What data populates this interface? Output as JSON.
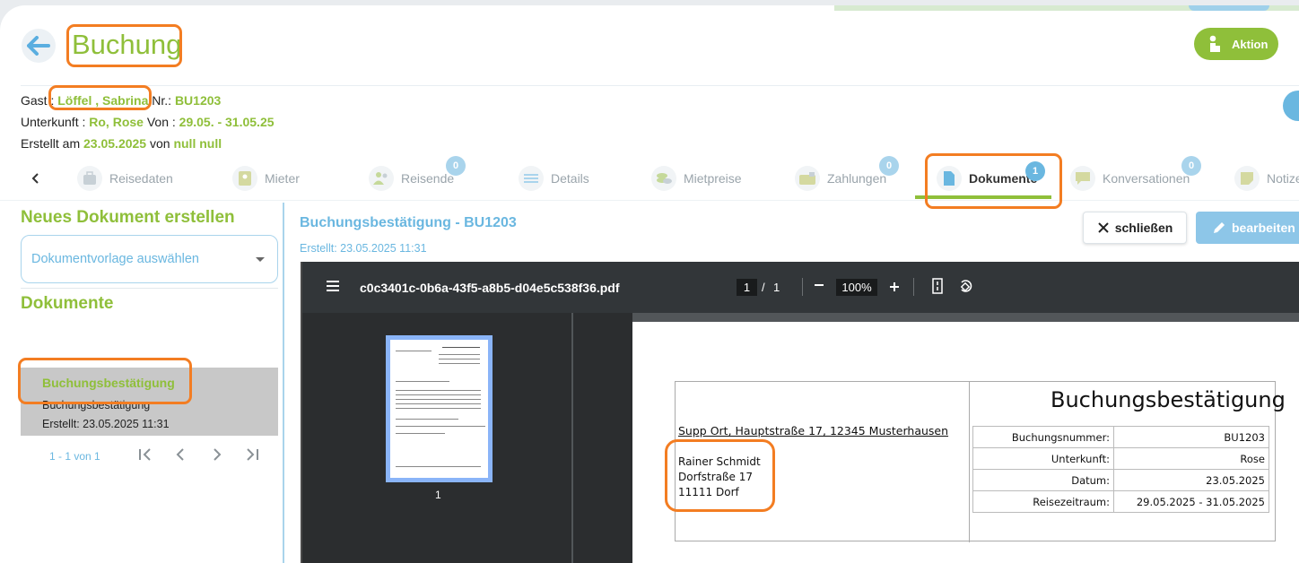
{
  "header": {
    "title": "Buchung",
    "action_label": "Aktion"
  },
  "info": {
    "guest_label": "Gast :",
    "guest_name": "Löffel , Sabrina",
    "nr_label": "Nr.:",
    "nr_value": "BU1203",
    "accommodation_label": "Unterkunft :",
    "accommodation_value": "Ro, Rose",
    "from_label": "Von :",
    "date_range": "29.05. - 31.05.25",
    "created_label": "Erstellt am",
    "created_date": "23.05.2025",
    "by_label": "von",
    "created_by": "null null"
  },
  "tabs": [
    {
      "label": "Reisedaten",
      "icon": "suitcase-icon"
    },
    {
      "label": "Mieter",
      "icon": "contact-card-icon"
    },
    {
      "label": "Reisende",
      "icon": "people-icon",
      "badge": "0"
    },
    {
      "label": "Details",
      "icon": "lines-icon"
    },
    {
      "label": "Mietpreise",
      "icon": "coins-icon"
    },
    {
      "label": "Zahlungen",
      "icon": "wallet-icon",
      "badge": "0"
    },
    {
      "label": "Dokumente",
      "icon": "document-icon",
      "badge": "1",
      "active": true
    },
    {
      "label": "Konversationen",
      "icon": "chat-icon",
      "badge": "0"
    },
    {
      "label": "Notize",
      "icon": "note-icon"
    }
  ],
  "left": {
    "new_doc_title": "Neues Dokument erstellen",
    "template_placeholder": "Dokumentvorlage auswählen",
    "docs_title": "Dokumente",
    "doc_item": {
      "name": "Buchungsbestätigung",
      "type": "Buchungsbestätigung",
      "created": "Erstellt: 23.05.2025 11:31"
    },
    "pager_text": "1 - 1 von 1"
  },
  "doc": {
    "title": "Buchungsbestätigung - BU1203",
    "created": "Erstellt: 23.05.2025 11:31",
    "close_label": "schließen",
    "edit_label": "bearbeiten"
  },
  "viewer": {
    "filename": "c0c3401c-0b6a-43f5-a8b5-d04e5c538f36.pdf",
    "page_current": "1",
    "page_sep": "/",
    "page_total": "1",
    "zoom": "100%",
    "thumb_number": "1"
  },
  "pdf": {
    "title": "Buchungsbestätigung",
    "sender": "Supp Ort, Hauptstraße 17, 12345 Musterhausen",
    "recipient": [
      "Rainer Schmidt",
      "Dorfstraße 17",
      "11111 Dorf"
    ],
    "rows": [
      {
        "k": "Buchungsnummer:",
        "v": "BU1203"
      },
      {
        "k": "Unterkunft:",
        "v": "Rose"
      },
      {
        "k": "Datum:",
        "v": "23.05.2025"
      },
      {
        "k": "Reisezeitraum:",
        "v": "29.05.2025 - 31.05.2025"
      }
    ]
  },
  "colors": {
    "accent_green": "#8fbf3a",
    "accent_blue": "#6ab7e0",
    "highlight_orange": "#f37d22"
  }
}
